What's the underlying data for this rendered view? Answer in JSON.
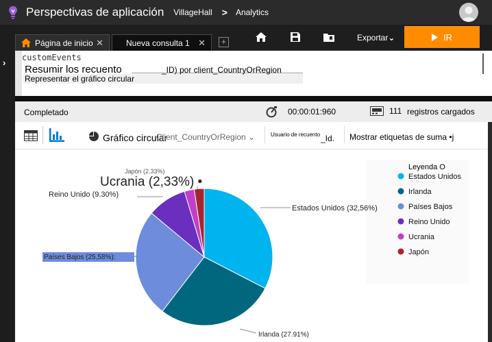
{
  "app": {
    "title": "Perspectivas de aplicación",
    "breadcrumb": [
      "VillageHall",
      "Analytics"
    ]
  },
  "tabs": [
    {
      "label": "Página de inicio",
      "close": "✕"
    },
    {
      "label": "Nueva consulta 1",
      "close": "✕"
    }
  ],
  "toolbar": {
    "add": "+",
    "export_label": "Exportar",
    "run_label": "IR",
    "run_color": "#ff8c00"
  },
  "editor": {
    "line1": "customEvents",
    "line2_main": "Resumir los recuento",
    "line2_rest": "_ID) por client_CountryOrRegion",
    "line3": "Representar el gráfico circular"
  },
  "status": {
    "state": "Completado",
    "time": "00:00:01:960",
    "count": "111",
    "records_label": "registros cargados"
  },
  "chart_toolbar": {
    "chart_type": "Gráfico circular",
    "split_by": "Client_CountryOrRegion",
    "value_a": "Usuario de recuento",
    "value_b": "_Id.",
    "show_sum": "Mostrar etiquetas de suma •j"
  },
  "chart_data": {
    "type": "pie",
    "legend_title": "Leyenda O",
    "slices": [
      {
        "name": "Estados Unidos",
        "value": 32.56,
        "label": "Estados Unidos (32,56%)",
        "color": "#00b4f0"
      },
      {
        "name": "Irlanda",
        "value": 27.91,
        "label": "Irlanda (27.91%)",
        "color": "#00677f"
      },
      {
        "name": "Países Bajos",
        "value": 25.58,
        "label": "Países Bajos (25,58%):",
        "color": "#6d8cdc"
      },
      {
        "name": "Reino Unido",
        "value": 9.3,
        "label": "Reino Unido (9.30%)",
        "color": "#6a2fbf"
      },
      {
        "name": "Ucrania",
        "value": 2.33,
        "label": "Ucrania (2,33%) •",
        "color": "#c040c8"
      },
      {
        "name": "Japón",
        "value": 2.33,
        "label": "Japón (2.33%)",
        "color": "#a4262c"
      }
    ]
  }
}
